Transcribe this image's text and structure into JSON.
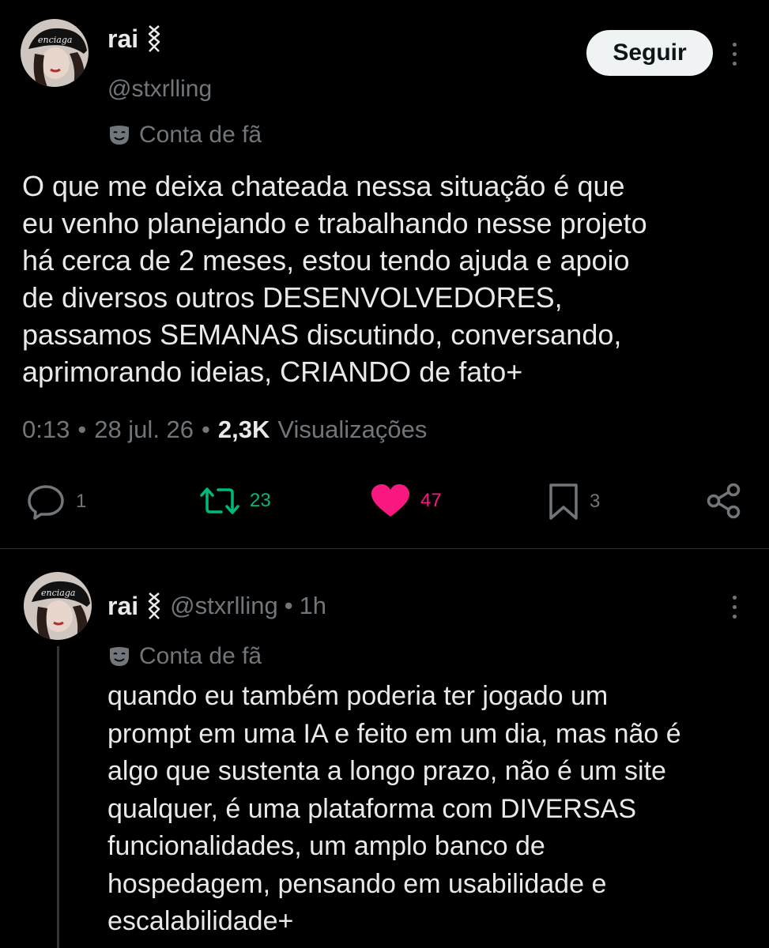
{
  "main_tweet": {
    "author_name": "rai",
    "author_handle": "@stxrlling",
    "account_label": "Conta de fã",
    "follow_label": "Seguir",
    "text": "O que me deixa chateada nessa situação é que\neu venho planejando e trabalhando nesse projeto\nhá cerca de 2 meses, estou tendo ajuda e apoio\nde diversos outros DESENVOLVEDORES,\npassamos SEMANAS discutindo, conversando,\naprimorando ideias, CRIANDO de fato+",
    "time": "0:13",
    "separator": "•",
    "date": "28 jul. 26",
    "views_count": "2,3K",
    "views_label": "Visualizações",
    "actions": {
      "replies": "1",
      "reposts": "23",
      "likes": "47",
      "bookmarks": "3"
    }
  },
  "reply_tweet": {
    "author_name": "rai",
    "author_handle": "@stxrlling",
    "separator": "•",
    "age": "1h",
    "account_label": "Conta de fã",
    "text": "quando eu também poderia ter jogado um\nprompt em uma IA e feito em um dia, mas não é\nalgo que sustenta a longo prazo, não é um site\nqualquer, é uma plataforma com DIVERSAS\nfuncionalidades, um amplo banco de\nhospedagem, pensando em usabilidade e\nescalabilidade+"
  },
  "colors": {
    "background": "#000000",
    "text_primary": "#e7e9ea",
    "text_secondary": "#71767b",
    "repost_green": "#00ba7c",
    "like_pink": "#f91880",
    "divider": "#2f3336"
  },
  "icons": {
    "reply": "speech-bubble-icon",
    "repost": "repost-arrows-icon",
    "like": "heart-icon",
    "bookmark": "bookmark-icon",
    "share": "share-nodes-icon",
    "fan": "theater-mask-icon",
    "more": "vertical-ellipsis-icon",
    "verified": "chain-link-icon"
  }
}
